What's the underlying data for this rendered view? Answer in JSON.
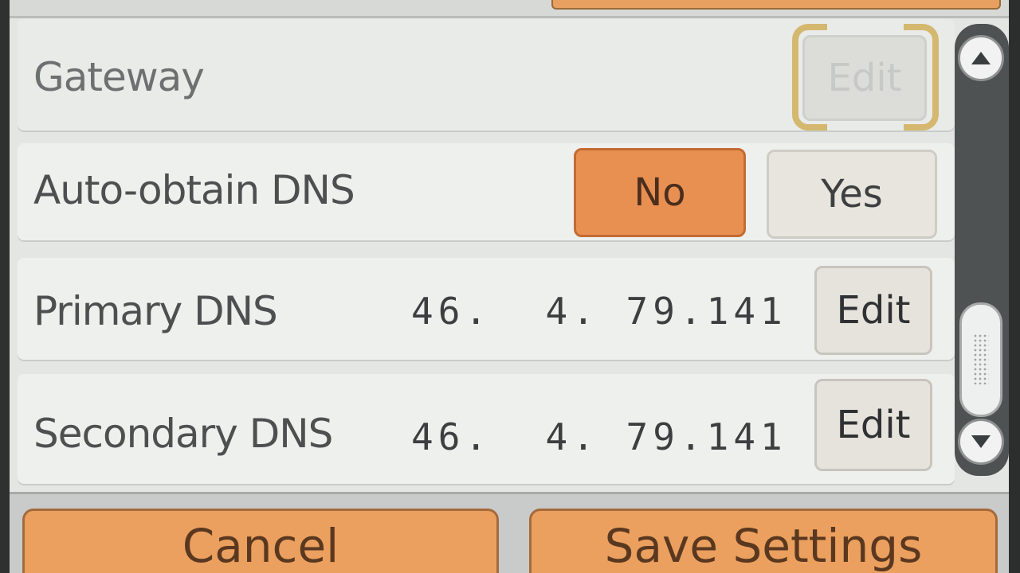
{
  "settings": {
    "gateway": {
      "label": "Gateway",
      "edit_label": "Edit",
      "state": "disabled"
    },
    "auto_dns": {
      "label": "Auto-obtain DNS",
      "options": [
        "No",
        "Yes"
      ],
      "selected": "No"
    },
    "primary_dns": {
      "label": "Primary DNS",
      "value": "46.  4. 79.141",
      "edit_label": "Edit"
    },
    "secondary_dns": {
      "label": "Secondary DNS",
      "value": "46.  4. 79.141",
      "edit_label": "Edit"
    }
  },
  "footer": {
    "cancel_label": "Cancel",
    "save_label": "Save Settings"
  },
  "colors": {
    "accent_orange": "#e88f52",
    "selection_bracket": "#d4b870",
    "background": "#e4e6e4"
  },
  "icons": {
    "scroll_up": "triangle-up-icon",
    "scroll_down": "triangle-down-icon"
  }
}
